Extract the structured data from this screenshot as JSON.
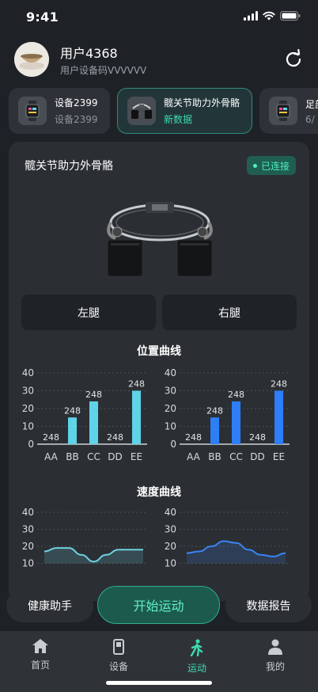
{
  "status_bar": {
    "time": "9:41"
  },
  "user": {
    "name": "用户4368",
    "device_code": "用户设备码VVVVVV"
  },
  "devices": [
    {
      "name": "设备2399",
      "sub": "设备2399",
      "icon": "smartwatch-icon"
    },
    {
      "name": "髋关节助力外骨骼",
      "sub": "新数据",
      "icon": "exoskeleton-icon"
    },
    {
      "name": "足部",
      "sub": "6/",
      "icon": "smartwatch-icon"
    }
  ],
  "panel": {
    "title": "髋关节助力外骨骼",
    "connection_status": "已连接",
    "left_leg_label": "左腿",
    "right_leg_label": "右腿",
    "position_curve_title": "位置曲线",
    "speed_curve_title": "速度曲线"
  },
  "chart_data": [
    {
      "type": "bar",
      "title": "位置曲线",
      "categories": [
        "AA",
        "BB",
        "CC",
        "DD",
        "EE"
      ],
      "values": [
        0,
        15,
        24,
        0,
        30
      ],
      "data_labels": [
        "248",
        "248",
        "248",
        "248",
        "248"
      ],
      "ylim": [
        0,
        40
      ],
      "yticks": [
        0,
        10,
        20,
        30,
        40
      ],
      "color": "#5fd3e8",
      "grid": true
    },
    {
      "type": "bar",
      "title": "位置曲线",
      "categories": [
        "AA",
        "BB",
        "CC",
        "DD",
        "EE"
      ],
      "values": [
        0,
        15,
        24,
        0,
        30
      ],
      "data_labels": [
        "248",
        "248",
        "248",
        "248",
        "248"
      ],
      "ylim": [
        0,
        40
      ],
      "yticks": [
        0,
        10,
        20,
        30,
        40
      ],
      "color": "#2d7ef7",
      "grid": true
    },
    {
      "type": "area",
      "title": "速度曲线",
      "x": [
        0,
        1,
        2,
        3,
        4,
        5,
        6,
        7,
        8
      ],
      "values": [
        17,
        19,
        19,
        15,
        11,
        15,
        18,
        18,
        18
      ],
      "ylim": [
        0,
        40
      ],
      "yticks": [
        10,
        20,
        30,
        40
      ],
      "color": "#6fd0e0",
      "grid": true
    },
    {
      "type": "area",
      "title": "速度曲线",
      "x": [
        0,
        1,
        2,
        3,
        4,
        5,
        6,
        7,
        8
      ],
      "values": [
        16,
        17,
        20,
        23,
        22,
        18,
        15,
        14,
        16
      ],
      "ylim": [
        0,
        40
      ],
      "yticks": [
        10,
        20,
        30,
        40
      ],
      "color": "#3a84f5",
      "grid": true
    }
  ],
  "actions": {
    "health_assistant": "健康助手",
    "start_exercise": "开始运动",
    "data_report": "数据报告"
  },
  "tabs": [
    {
      "label": "首页",
      "icon": "home-icon",
      "active": false
    },
    {
      "label": "设备",
      "icon": "device-icon",
      "active": false
    },
    {
      "label": "运动",
      "icon": "walking-icon",
      "active": true
    },
    {
      "label": "我的",
      "icon": "profile-icon",
      "active": false
    }
  ]
}
